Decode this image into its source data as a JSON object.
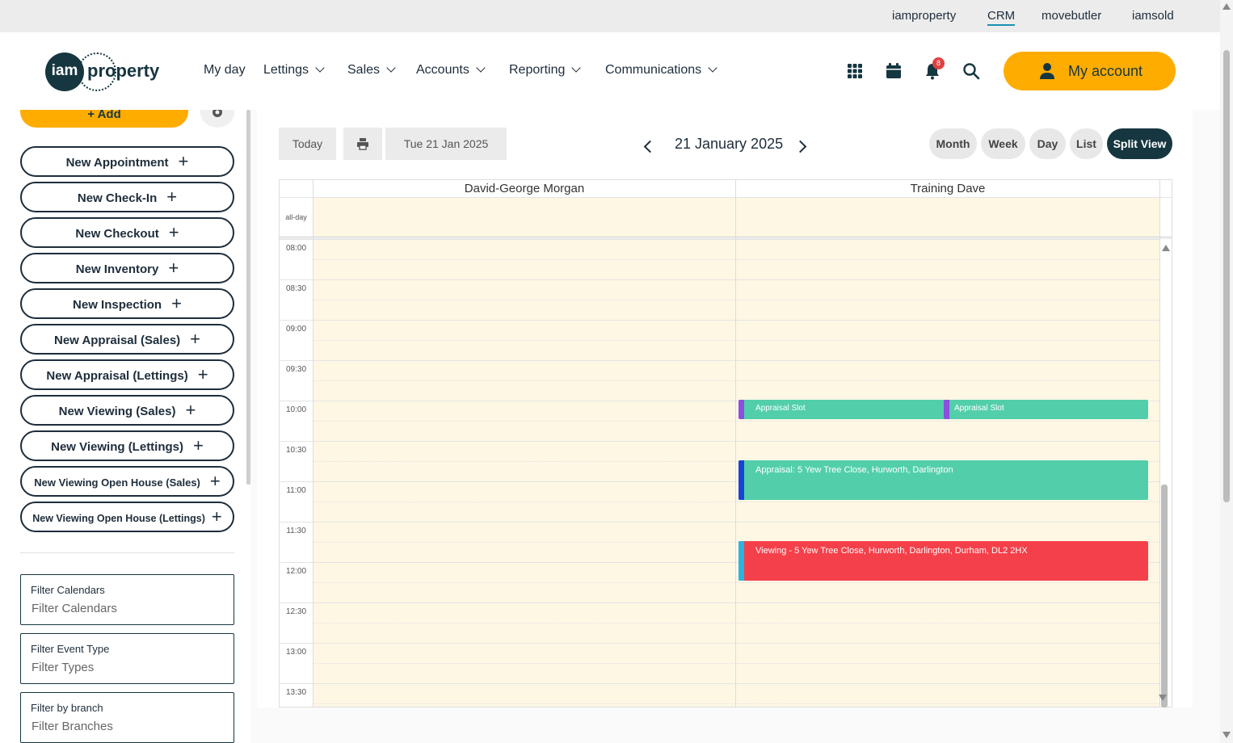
{
  "topbar": {
    "links": [
      "iamproperty",
      "CRM",
      "movebutler",
      "iamsold"
    ],
    "active": "CRM"
  },
  "logo": {
    "circle_text": "iam",
    "word": "property"
  },
  "nav": {
    "items": [
      "My day",
      "Lettings",
      "Sales",
      "Accounts",
      "Reporting",
      "Communications"
    ]
  },
  "header": {
    "notification_count": "8",
    "account_label": "My account"
  },
  "sidebar": {
    "add_label": "Add",
    "actions": [
      "New Appointment",
      "New Check-In",
      "New Checkout",
      "New Inventory",
      "New Inspection",
      "New Appraisal (Sales)",
      "New Appraisal (Lettings)",
      "New Viewing (Sales)",
      "New Viewing (Lettings)",
      "New Viewing Open House (Sales)",
      "New Viewing Open House (Lettings)"
    ],
    "filters": [
      {
        "label": "Filter Calendars",
        "placeholder": "Filter Calendars"
      },
      {
        "label": "Filter Event Type",
        "placeholder": "Filter Types"
      },
      {
        "label": "Filter by branch",
        "placeholder": "Filter Branches"
      }
    ]
  },
  "toolbar": {
    "today": "Today",
    "date_picker": "Tue 21 Jan 2025",
    "title": "21 January 2025",
    "views": [
      "Month",
      "Week",
      "Day",
      "List",
      "Split View"
    ],
    "active_view": "Split View"
  },
  "calendar": {
    "columns": [
      "David-George Morgan",
      "Training Dave"
    ],
    "allday_label": "all-day",
    "times": [
      "08:00",
      "08:30",
      "09:00",
      "09:30",
      "10:00",
      "10:30",
      "11:00",
      "11:30",
      "12:00",
      "12:30",
      "13:00",
      "13:30"
    ],
    "events": [
      {
        "title": "Appraisal Slot",
        "color": "#52cfaa",
        "bar": "#8c4fe0"
      },
      {
        "title": "Appraisal Slot",
        "color": "#52cfaa",
        "bar": "#8c4fe0"
      },
      {
        "title": "Appraisal: 5 Yew Tree Close, Hurworth, Darlington",
        "color": "#52cfaa",
        "bar": "#1844d6"
      },
      {
        "title": "Viewing - 5 Yew Tree Close, Hurworth, Darlington, Durham, DL2 2HX",
        "color": "#f4404a",
        "bar": "#2ab4e0"
      }
    ]
  }
}
